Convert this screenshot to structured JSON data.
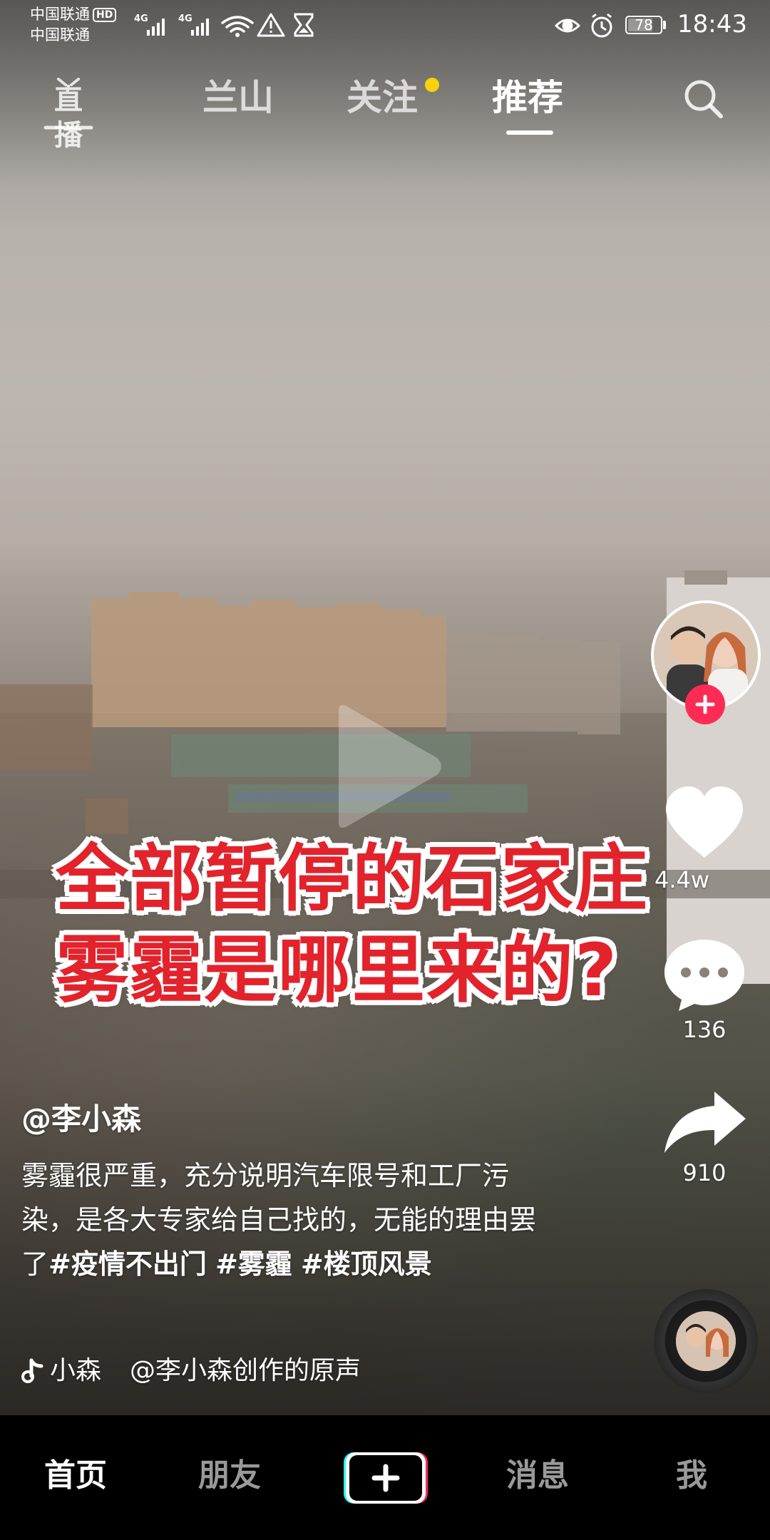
{
  "status_bar": {
    "carrier_1": "中国联通",
    "carrier_1_badge": "HD",
    "carrier_2": "中国联通",
    "network_1": "4G",
    "network_2": "4G",
    "battery": "78",
    "battery_level": 0.78,
    "time": "18:43"
  },
  "top_nav": {
    "live_label": "直播",
    "tabs": [
      {
        "label": "兰山",
        "active": false
      },
      {
        "label": "关注",
        "active": false,
        "has_dot": true
      },
      {
        "label": "推荐",
        "active": true
      }
    ],
    "search_icon": "search-icon"
  },
  "video": {
    "overlay_lines": [
      "全部暂停的石家庄",
      "雾霾是哪里来的?"
    ],
    "paused": true
  },
  "actions": {
    "like_count": "4.4w",
    "comment_count": "136",
    "share_count": "910"
  },
  "post": {
    "author": "@李小森",
    "description_text": "雾霾很严重，充分说明汽车限号和工厂污染，是各大专家给自己找的，无能的理由罢了",
    "hashtags": [
      "#疫情不出门",
      "#雾霾",
      "#楼顶风景"
    ],
    "music_name": "小森",
    "music_original": "@李小森创作的原声"
  },
  "bottom_tabs": {
    "home": "首页",
    "friends": "朋友",
    "messages": "消息",
    "me": "我"
  },
  "colors": {
    "accent_red": "#fe2c55",
    "caption_red": "#e2232c",
    "notify_dot": "#f8d20a"
  }
}
